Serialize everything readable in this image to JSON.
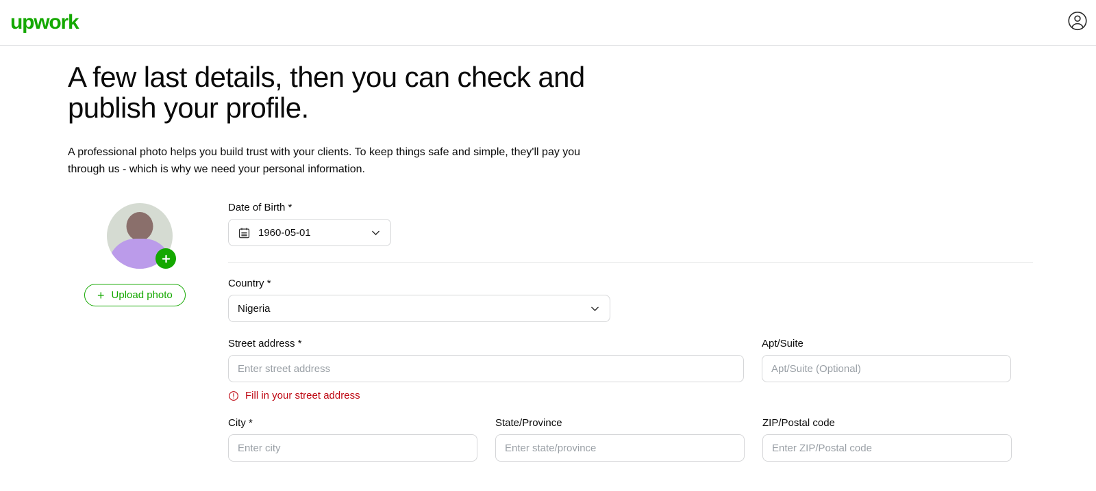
{
  "header": {
    "logo_text": "upwork",
    "logo_color": "#14a800",
    "account_icon": "account-circle-icon"
  },
  "main": {
    "headline": "A few last details, then you can check and publish your profile.",
    "description": "A professional photo helps you build trust with your clients. To keep things safe and simple, they'll pay you through us - which is why we need your personal information."
  },
  "photo": {
    "avatar_alt": "profile-photo-placeholder",
    "add_badge_icon": "plus-icon",
    "upload_button_label": "Upload photo",
    "upload_button_icon": "plus-icon",
    "accent_color": "#14a800"
  },
  "form": {
    "date_of_birth": {
      "label": "Date of Birth *",
      "value": "1960-05-01",
      "icon": "calendar-icon",
      "chevron": "chevron-down-icon"
    },
    "country": {
      "label": "Country *",
      "value": "Nigeria",
      "chevron": "chevron-down-icon"
    },
    "street_address": {
      "label": "Street address *",
      "value": "",
      "placeholder": "Enter street address",
      "error": "Fill in your street address",
      "error_icon": "alert-circle-icon",
      "error_color": "#be0611"
    },
    "apt_suite": {
      "label": "Apt/Suite",
      "value": "",
      "placeholder": "Apt/Suite (Optional)"
    },
    "city": {
      "label": "City *",
      "value": "",
      "placeholder": "Enter city"
    },
    "state_province": {
      "label": "State/Province",
      "value": "",
      "placeholder": "Enter state/province"
    },
    "zip_postal": {
      "label": "ZIP/Postal code",
      "value": "",
      "placeholder": "Enter ZIP/Postal code"
    }
  }
}
